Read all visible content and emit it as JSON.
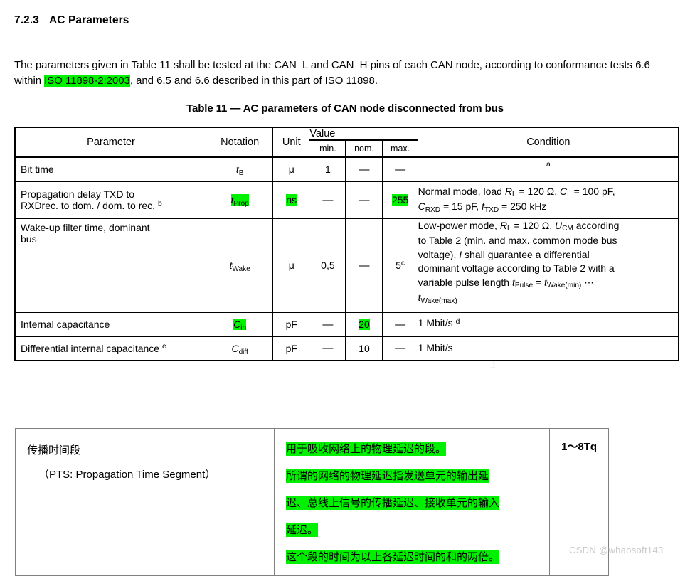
{
  "document": {
    "section_number": "7.2.3",
    "section_title": "AC Parameters",
    "intro": {
      "part1": "The parameters given in Table 11 shall be tested at the CAN_L and CAN_H pins of each CAN node, according to conformance tests 6.6 within ",
      "highlight": "ISO 11898-2:2003",
      "part2": ", and 6.5 and 6.6 described in this part of ISO 11898."
    },
    "table_caption": "Table 11 — AC parameters of CAN node disconnected from bus"
  },
  "ac_table": {
    "headers": {
      "parameter": "Parameter",
      "notation": "Notation",
      "unit": "Unit",
      "value": "Value",
      "min": "min.",
      "nom": "nom.",
      "max": "max.",
      "condition": "Condition"
    },
    "rows": [
      {
        "parameter": "Bit time",
        "notation_base": "t",
        "notation_sub": "B",
        "unit": "μ",
        "min": "1",
        "nom": "—",
        "max": "—",
        "condition_footnote": "a"
      },
      {
        "parameter_line1": "Propagation delay TXD to",
        "parameter_line2": "RXDrec. to dom. / dom. to rec. ",
        "parameter_footnote": "b",
        "notation_base": "t",
        "notation_sub": "Prop",
        "unit": "ns",
        "min": "—",
        "nom": "—",
        "max": "255",
        "condition_line1_a": "Normal mode, load ",
        "condition_RL": "R",
        "condition_RL_sub": "L",
        "condition_line1_b": " = 120 Ω, ",
        "condition_CL": "C",
        "condition_CL_sub": "L",
        "condition_line1_c": " = 100 pF,",
        "condition_CRXD": "C",
        "condition_CRXD_sub": "RXD",
        "condition_line2_a": " =  15 pF, ",
        "condition_fTXD": "f",
        "condition_fTXD_sub": "TXD",
        "condition_line2_b": " = 250 kHz"
      },
      {
        "parameter_line1": "Wake-up filter time, dominant",
        "parameter_line2": "bus",
        "notation_base": "t",
        "notation_sub": "Wake",
        "unit": "μ",
        "min": "0,5",
        "nom": "—",
        "max": "5",
        "max_footnote": "c",
        "condition_l1a": "Low-power mode, ",
        "condition_RL": "R",
        "condition_RL_sub": "L",
        "condition_l1b": " = 120 Ω, ",
        "condition_UCM": "U",
        "condition_UCM_sub": "CM",
        "condition_l1c": " according",
        "condition_l2": "to Table 2 (min. and max. common mode bus",
        "condition_l3a": "voltage), ",
        "condition_I": "I",
        "condition_l3b": " shall guarantee a differential",
        "condition_l4": "dominant voltage according to Table 2 with a",
        "condition_l5a": "variable pulse length ",
        "condition_tPulse": "t",
        "condition_tPulse_sub": "Pulse",
        "condition_l5b": " = ",
        "condition_tWakeMin": "t",
        "condition_tWakeMin_sub": "Wake(min)",
        "condition_ellipsis": " ⋯",
        "condition_l6": "t",
        "condition_l6_sub": "Wake(max)"
      },
      {
        "parameter": "Internal capacitance",
        "notation_base": "C",
        "notation_sub": "in",
        "unit": "pF",
        "min": "—",
        "nom": "20",
        "max": "—",
        "condition": "1 Mbit/s ",
        "condition_footnote": "d"
      },
      {
        "parameter": "Differential internal capacitance ",
        "parameter_footnote": "e",
        "notation_base": "C",
        "notation_sub": "diff",
        "unit": "pF",
        "min": "—",
        "nom": "10",
        "max": "—",
        "condition": "1 Mbit/s"
      }
    ]
  },
  "cn_table": {
    "term_line1": "传播时间段",
    "term_line2": "（PTS: Propagation Time Segment）",
    "description": [
      "用于吸收网络上的物理延迟的段。",
      "所谓的网络的物理延迟指发送单元的输出延",
      "迟、总线上信号的传播延迟、接收单元的输入",
      "延迟。",
      "这个段的时间为以上各延迟时间的和的两倍。"
    ],
    "range": "1～8Tq"
  },
  "watermark": "CSDN @whaosoft143",
  "ghost_artifact": "2",
  "colors": {
    "highlight": "#00f000",
    "text": "#000000",
    "table_border": "#000000",
    "cn_table_border": "#808080",
    "watermark": "#c9c9c9"
  }
}
